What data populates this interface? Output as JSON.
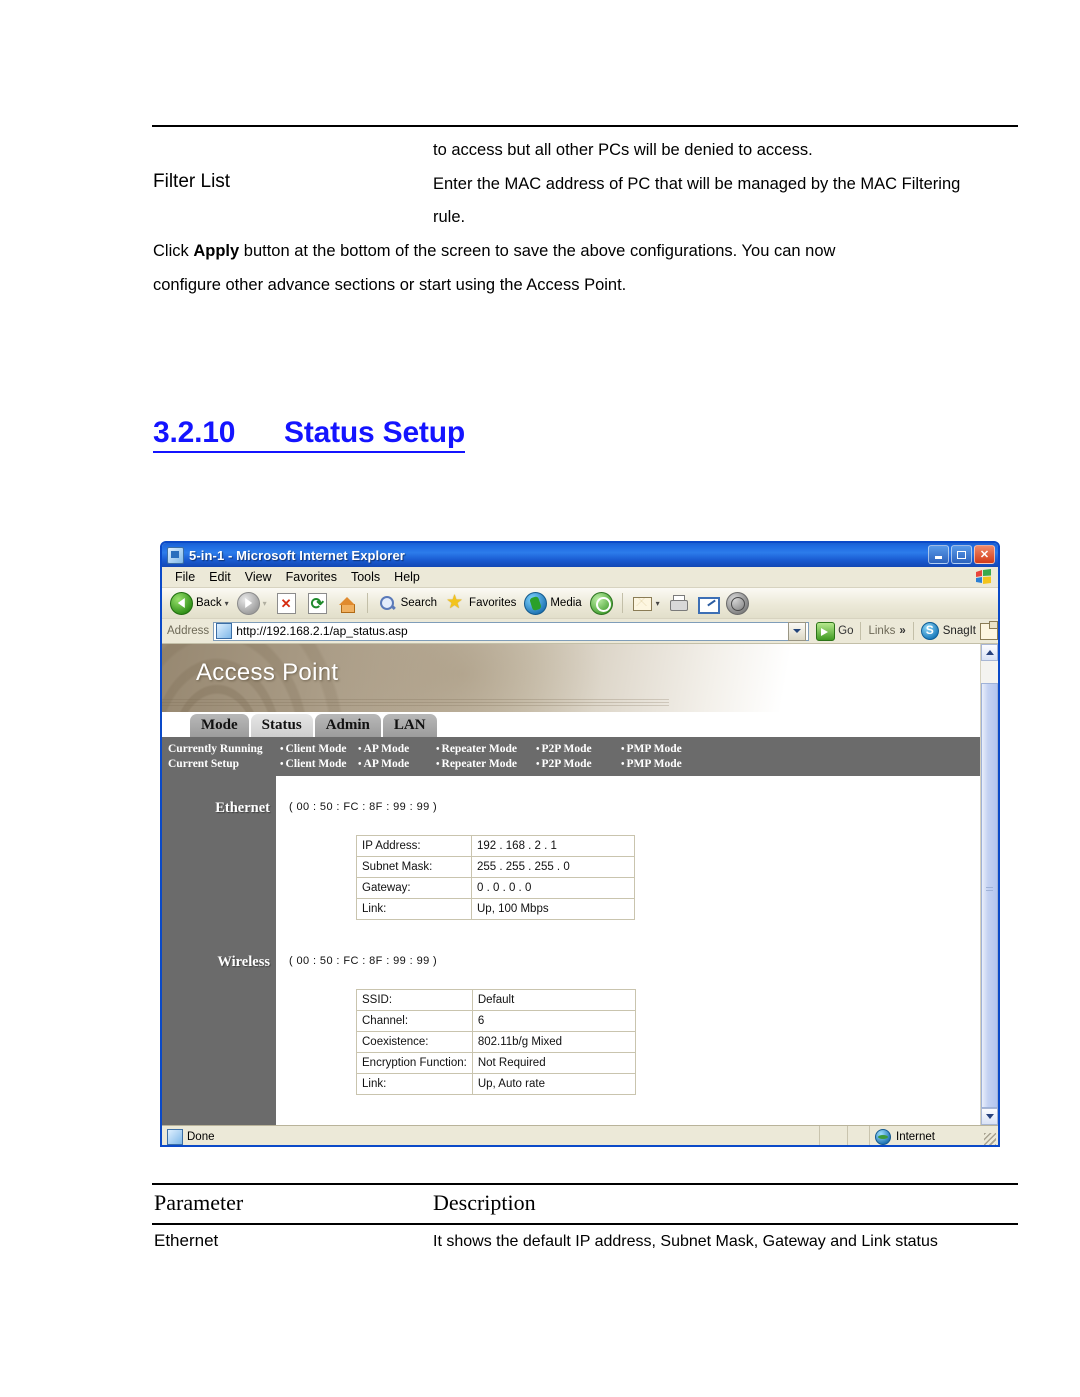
{
  "document": {
    "body_lines": {
      "access_denied": "to access but all other PCs will be denied to access.",
      "filter_list_label": "Filter List",
      "filter_list_desc_1": "Enter the MAC address of PC that will be managed by the MAC Filtering",
      "filter_list_desc_2": "rule.",
      "click_apply_pre": "Click ",
      "click_apply_bold": "Apply",
      "click_apply_post": " button at the bottom of the screen to save the above configurations. You can now",
      "configure_line": "configure other advance sections or start using the Access Point."
    },
    "section_heading": {
      "number": "3.2.10",
      "title": "Status Setup",
      "full": "3.2.10      Status Setup",
      "color": "#1414ff"
    },
    "param_table": {
      "header_parameter": "Parameter",
      "header_description": "Description",
      "rows": [
        {
          "parameter": "Ethernet",
          "description": "It shows the default IP address, Subnet Mask, Gateway and Link status"
        }
      ]
    }
  },
  "browser": {
    "window_title": "5-in-1 - Microsoft Internet Explorer",
    "window_controls": {
      "minimize": "_",
      "maximize": "□",
      "close": "✕"
    },
    "menu_items": [
      "File",
      "Edit",
      "View",
      "Favorites",
      "Tools",
      "Help"
    ],
    "toolbar": {
      "back_label": "Back",
      "forward_label": "",
      "search_label": "Search",
      "favorites_label": "Favorites",
      "media_label": "Media",
      "icons": [
        "back-icon",
        "forward-icon",
        "stop-icon",
        "refresh-icon",
        "home-icon",
        "search-icon",
        "favorites-star-icon",
        "media-icon",
        "history-icon",
        "mail-icon",
        "print-icon",
        "edit-icon",
        "discuss-icon"
      ]
    },
    "address_bar": {
      "label": "Address",
      "url": "http://192.168.2.1/ap_status.asp",
      "go_label": "Go",
      "links_label": "Links",
      "links_chevron": "»",
      "snagit_label": "SnagIt"
    },
    "status_bar": {
      "left_text": "Done",
      "zone_text": "Internet"
    }
  },
  "ap_page": {
    "banner_title": "Access Point",
    "tabs": [
      {
        "label": "Mode",
        "active": false
      },
      {
        "label": "Status",
        "active": true
      },
      {
        "label": "Admin",
        "active": false
      },
      {
        "label": "LAN",
        "active": false
      }
    ],
    "mode_rows": [
      {
        "label": "Currently Running",
        "modes": [
          "Client Mode",
          "AP Mode",
          "Repeater Mode",
          "P2P Mode",
          "PMP Mode"
        ]
      },
      {
        "label": "Current Setup",
        "modes": [
          "Client Mode",
          "AP Mode",
          "Repeater Mode",
          "P2P Mode",
          "PMP Mode"
        ]
      }
    ],
    "ethernet": {
      "section_label": "Ethernet",
      "mac": "( 00 : 50 : FC : 8F : 99 : 99 )",
      "rows": [
        {
          "key": "IP Address:",
          "value": "192 . 168 . 2 . 1"
        },
        {
          "key": "Subnet Mask:",
          "value": "255 . 255 . 255 . 0"
        },
        {
          "key": "Gateway:",
          "value": "0 . 0 . 0 . 0"
        },
        {
          "key": "Link:",
          "value": "Up, 100 Mbps"
        }
      ]
    },
    "wireless": {
      "section_label": "Wireless",
      "mac": "( 00 : 50 : FC : 8F : 99 : 99 )",
      "rows": [
        {
          "key": "SSID:",
          "value": "Default"
        },
        {
          "key": "Channel:",
          "value": "6"
        },
        {
          "key": "Coexistence:",
          "value": "802.11b/g Mixed"
        },
        {
          "key": "Encryption Function:",
          "value": "Not Required"
        },
        {
          "key": "Link:",
          "value": "Up,  Auto rate"
        }
      ]
    }
  }
}
